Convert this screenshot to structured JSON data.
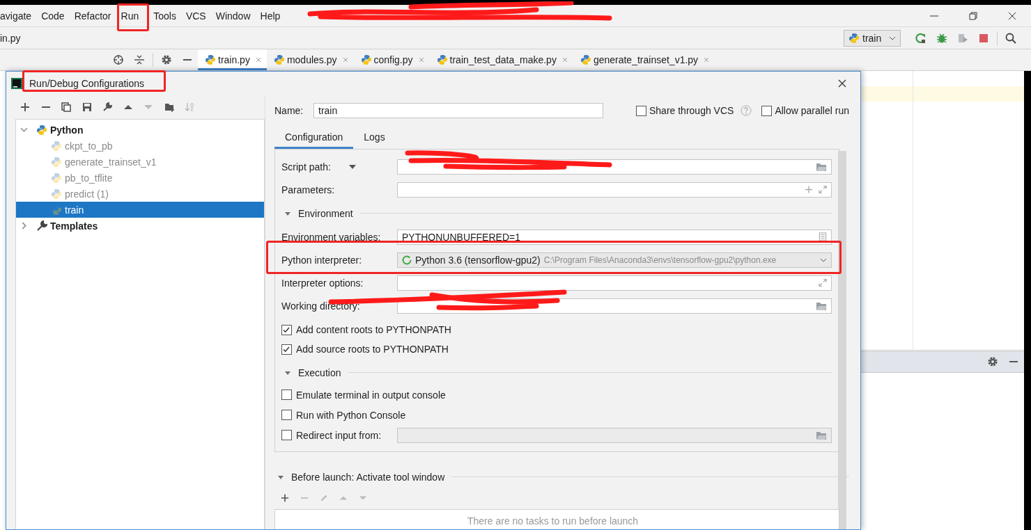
{
  "ide": {
    "menu": [
      {
        "label": "avigate"
      },
      {
        "label": "Code"
      },
      {
        "label": "Refactor"
      },
      {
        "label": "Run"
      },
      {
        "label": "Tools"
      },
      {
        "label": "VCS"
      },
      {
        "label": "Window"
      },
      {
        "label": "Help"
      }
    ],
    "breadcrumb": "in.py",
    "run_config": "train",
    "tabs": [
      {
        "label": "train.py",
        "selected": true
      },
      {
        "label": "modules.py",
        "selected": false
      },
      {
        "label": "config.py",
        "selected": false
      },
      {
        "label": "train_test_data_make.py",
        "selected": false
      },
      {
        "label": "generate_trainset_v1.py",
        "selected": false
      }
    ]
  },
  "dialog": {
    "title": "Run/Debug Configurations",
    "tree": [
      {
        "label": "Python",
        "expanded": true,
        "kind": "python",
        "children": [
          {
            "label": "ckpt_to_pb",
            "selected": false
          },
          {
            "label": "generate_trainset_v1",
            "selected": false
          },
          {
            "label": "pb_to_tflite",
            "selected": false
          },
          {
            "label": "predict (1)",
            "selected": false
          },
          {
            "label": "train",
            "selected": true
          }
        ]
      },
      {
        "label": "Templates",
        "expanded": false,
        "kind": "templates"
      }
    ],
    "name_label": "Name:",
    "name": "train",
    "options": [
      {
        "label": "Share through VCS",
        "checked": false,
        "help": true
      },
      {
        "label": "Allow parallel run",
        "checked": false,
        "help": false
      }
    ],
    "tabs": [
      {
        "label": "Configuration",
        "selected": true
      },
      {
        "label": "Logs",
        "selected": false
      }
    ],
    "script_path_label": "Script path:",
    "parameters_label": "Parameters:",
    "environment": {
      "title": "Environment",
      "expanded": true
    },
    "env_vars": {
      "label": "Environment variables:",
      "value": "PYTHONUNBUFFERED=1"
    },
    "interpreter": {
      "label": "Python interpreter:",
      "name": "Python 3.6 (tensorflow-gpu2)",
      "path": "C:\\Program Files\\Anaconda3\\envs\\tensorflow-gpu2\\python.exe"
    },
    "interpreter_options_label": "Interpreter options:",
    "working_dir_label": "Working directory:",
    "path_options": [
      {
        "label": "Add content roots to PYTHONPATH",
        "checked": true
      },
      {
        "label": "Add source roots to PYTHONPATH",
        "checked": true
      }
    ],
    "execution": {
      "title": "Execution",
      "expanded": true
    },
    "execution_options": [
      {
        "label": "Emulate terminal in output console",
        "checked": false
      },
      {
        "label": "Run with Python Console",
        "checked": false
      },
      {
        "label": "Redirect input from:",
        "checked": false
      }
    ],
    "before_launch": {
      "title": "Before launch: Activate tool window",
      "expanded": true,
      "empty_message": "There are no tasks to run before launch"
    }
  }
}
